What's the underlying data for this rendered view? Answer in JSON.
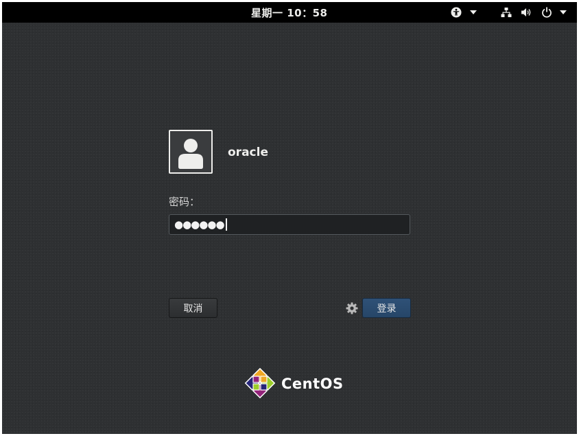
{
  "topbar": {
    "clock": "星期一 10：58",
    "icons": [
      "accessibility-icon",
      "chevron-down-icon",
      "network-wired-icon",
      "volume-icon",
      "power-icon",
      "chevron-down-icon"
    ]
  },
  "login": {
    "avatar_icon": "user-avatar-icon",
    "username": "oracle",
    "password_prompt": "密码：",
    "password_masked": "●●●●●●",
    "cancel_label": "取消",
    "login_label": "登录",
    "session_icon": "gear-icon"
  },
  "branding": {
    "logo_icon": "centos-logo-icon",
    "logo_text": "CentOS"
  },
  "colors": {
    "background": "#2e3032",
    "topbar": "#000000",
    "login_button": "#2a4b6e",
    "text": "#eeeeec"
  }
}
